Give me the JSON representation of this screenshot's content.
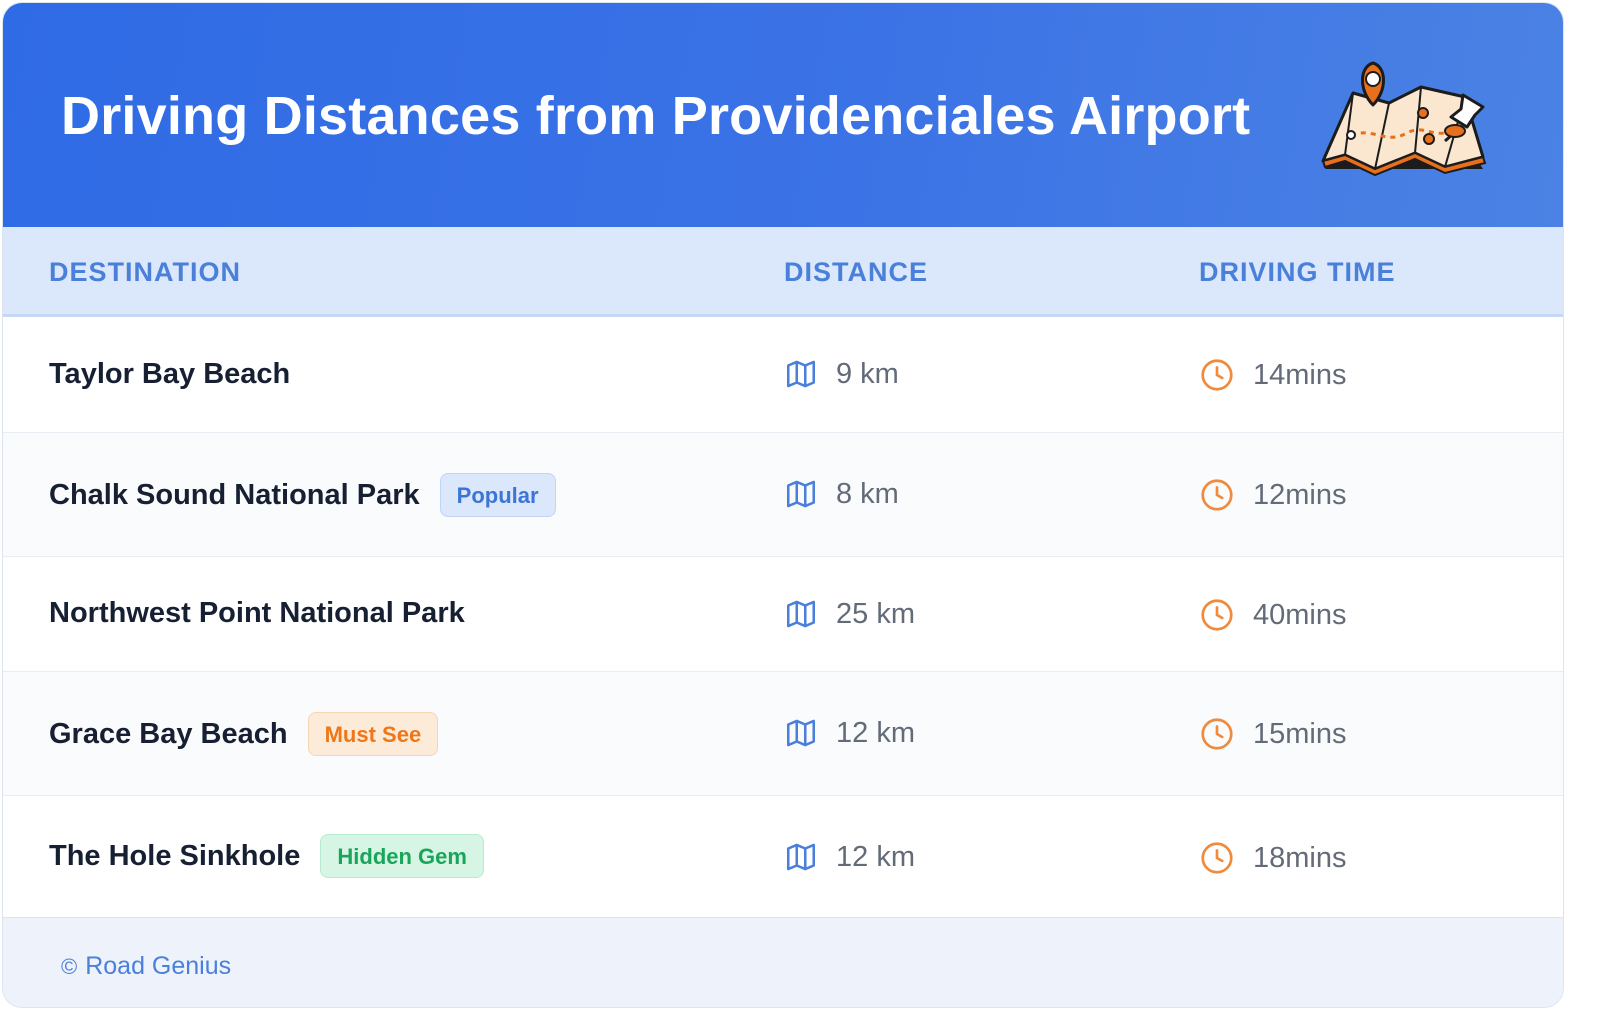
{
  "header": {
    "title": "Driving Distances from Providenciales Airport",
    "illustration": "map-with-pins-icon"
  },
  "table": {
    "columns": [
      "DESTINATION",
      "DISTANCE",
      "DRIVING TIME"
    ],
    "rows": [
      {
        "destination": "Taylor Bay Beach",
        "badge": "",
        "distance": "9 km",
        "time": "14mins"
      },
      {
        "destination": "Chalk Sound National Park",
        "badge": "Popular",
        "badge_color": "blue",
        "distance": "8 km",
        "time": "12mins"
      },
      {
        "destination": "Northwest Point National Park",
        "badge": "",
        "distance": "25 km",
        "time": "40mins"
      },
      {
        "destination": "Grace Bay Beach",
        "badge": "Must See",
        "badge_color": "orange",
        "distance": "12 km",
        "time": "15mins"
      },
      {
        "destination": "The Hole Sinkhole",
        "badge": "Hidden Gem",
        "badge_color": "green",
        "distance": "12 km",
        "time": "18mins"
      }
    ],
    "distance_icon": "map-icon",
    "time_icon": "clock-icon"
  },
  "footer": {
    "copyright_symbol": "©",
    "text": "Road Genius"
  },
  "colors": {
    "header_start": "#2f6be5",
    "header_end": "#4b82e4",
    "accent_blue": "#4a7fda",
    "accent_orange": "#f0761a",
    "accent_green": "#1aa65a"
  }
}
